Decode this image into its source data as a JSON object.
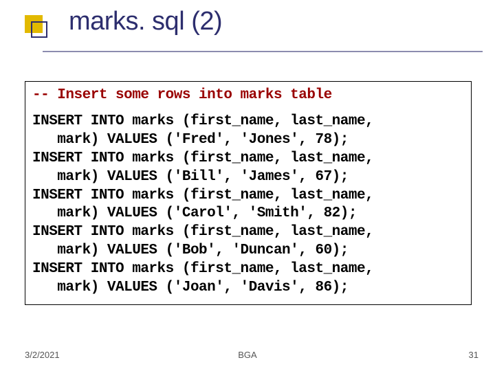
{
  "title": "marks. sql (2)",
  "comment": "-- Insert some rows into marks table",
  "statements": [
    "INSERT INTO marks (first_name, last_name,\n   mark) VALUES ('Fred', 'Jones', 78);",
    "INSERT INTO marks (first_name, last_name,\n   mark) VALUES ('Bill', 'James', 67);",
    "INSERT INTO marks (first_name, last_name,\n   mark) VALUES ('Carol', 'Smith', 82);",
    "INSERT INTO marks (first_name, last_name,\n   mark) VALUES ('Bob', 'Duncan', 60);",
    "INSERT INTO marks (first_name, last_name,\n   mark) VALUES ('Joan', 'Davis', 86);"
  ],
  "footer": {
    "date": "3/2/2021",
    "center": "BGA",
    "page": "31"
  }
}
